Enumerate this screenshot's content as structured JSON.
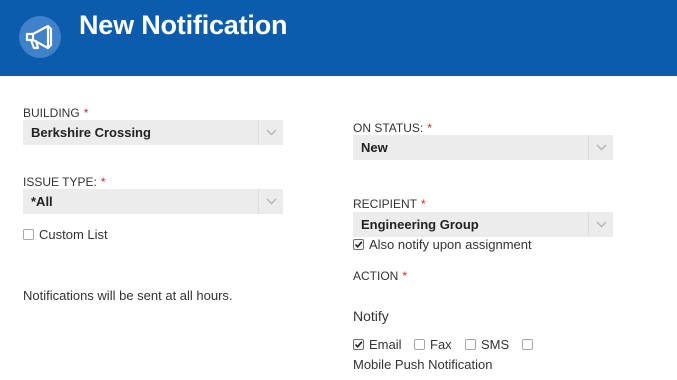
{
  "header": {
    "title": "New Notification",
    "icon": "megaphone-icon",
    "background": "#0b5cad"
  },
  "left": {
    "building": {
      "label": "BUILDING",
      "value": "Berkshire Crossing"
    },
    "issue_type": {
      "label": "ISSUE TYPE:",
      "value": "*All"
    },
    "custom_list": {
      "label": "Custom List",
      "checked": false
    },
    "hours_note": "Notifications will be sent at all hours."
  },
  "right": {
    "on_status": {
      "label": "ON STATUS:",
      "value": "New"
    },
    "recipient": {
      "label": "RECIPIENT",
      "value": "Engineering Group"
    },
    "also_notify": {
      "label": "Also notify upon assignment",
      "checked": true
    },
    "action": {
      "label": "ACTION"
    },
    "notify_heading": "Notify",
    "channels": {
      "email": {
        "label": "Email",
        "checked": true
      },
      "fax": {
        "label": "Fax",
        "checked": false
      },
      "sms": {
        "label": "SMS",
        "checked": false
      },
      "push": {
        "label": "Mobile Push Notification",
        "checked": false
      }
    }
  },
  "required_marker": "*",
  "colors": {
    "required": "#d9232d",
    "select_bg": "#ececec"
  }
}
